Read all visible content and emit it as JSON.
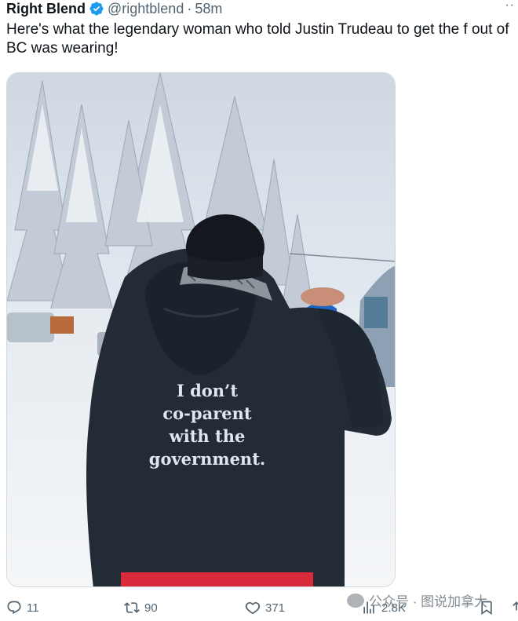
{
  "tweet": {
    "display_name": "Right Blend",
    "handle": "@rightblend",
    "separator": "·",
    "time": "58m",
    "more": "··",
    "text": "Here's what the legendary woman who told Justin Trudeau to get the f out of BC was wearing!"
  },
  "media": {
    "shirt_lines": [
      "I don’t",
      "co-parent",
      "with the",
      "government."
    ]
  },
  "actions": {
    "replies": "11",
    "retweets": "90",
    "likes": "371",
    "views": "2.8K"
  },
  "watermark": {
    "text": "公众号 · 图说加拿大"
  },
  "colors": {
    "verified": "#1d9bf0",
    "text": "#0f1419",
    "muted": "#536471",
    "hoodie": "#222a36",
    "snow_sky": "#dfe8f1"
  }
}
